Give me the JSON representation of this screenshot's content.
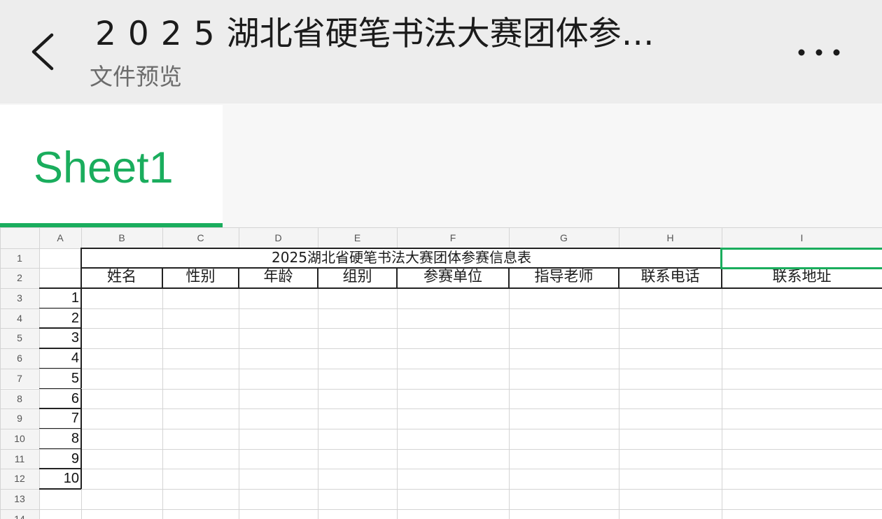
{
  "header": {
    "title_prefix": "2025",
    "title_rest": "湖北省硬笔书法大赛团体参…",
    "subtitle": "文件预览"
  },
  "tabs": [
    {
      "label": "Sheet1"
    }
  ],
  "sheet": {
    "column_headers": [
      "A",
      "B",
      "C",
      "D",
      "E",
      "F",
      "G",
      "H",
      "I"
    ],
    "row_headers": [
      "1",
      "2",
      "3",
      "4",
      "5",
      "6",
      "7",
      "8",
      "9",
      "10",
      "11",
      "12",
      "13",
      "14"
    ],
    "title": "2025湖北省硬笔书法大赛团体参赛信息表",
    "field_headers": [
      "姓名",
      "性别",
      "年龄",
      "组别",
      "参赛单位",
      "指导老师",
      "联系电话",
      "联系地址"
    ],
    "numbers": [
      "1",
      "2",
      "3",
      "4",
      "5",
      "6",
      "7",
      "8",
      "9",
      "10"
    ]
  },
  "colors": {
    "accent": "#1aad5d",
    "header_bg": "#ededed"
  }
}
